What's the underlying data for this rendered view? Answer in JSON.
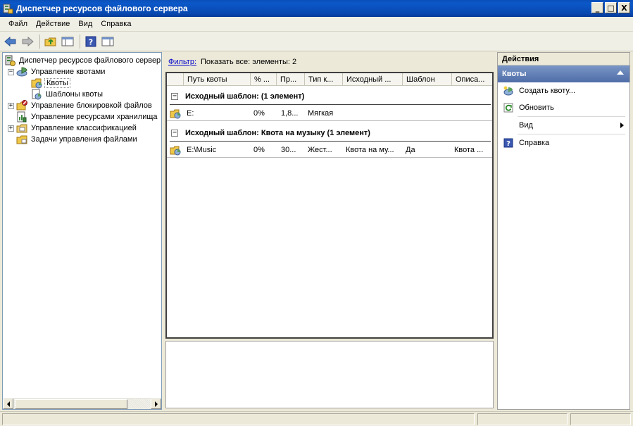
{
  "window": {
    "title": "Диспетчер ресурсов файлового сервера",
    "minimize": "_",
    "maximize": "□",
    "close": "X"
  },
  "menu": [
    "Файл",
    "Действие",
    "Вид",
    "Справка"
  ],
  "tree": [
    {
      "label": "Диспетчер ресурсов файлового сервер",
      "icon": "server-icon",
      "indent": 0,
      "expander": ""
    },
    {
      "label": "Управление квотами",
      "icon": "quota-management-icon",
      "indent": 1,
      "expander": "−"
    },
    {
      "label": "Квоты",
      "icon": "quota-folder-icon",
      "indent": 2,
      "expander": "",
      "selected": true
    },
    {
      "label": "Шаблоны квоты",
      "icon": "quota-template-icon",
      "indent": 2,
      "expander": ""
    },
    {
      "label": "Управление блокировкой файлов",
      "icon": "file-screen-icon",
      "indent": 1,
      "expander": "+"
    },
    {
      "label": "Управление ресурсами хранилища",
      "icon": "storage-report-icon",
      "indent": 1,
      "expander": ""
    },
    {
      "label": "Управление классификацией",
      "icon": "classification-icon",
      "indent": 1,
      "expander": "+"
    },
    {
      "label": "Задачи управления файлами",
      "icon": "file-tasks-icon",
      "indent": 1,
      "expander": ""
    }
  ],
  "filter": {
    "link": "Фильтр:",
    "text": "Показать все: элементы: 2"
  },
  "columns": [
    "Путь квоты",
    "% ...",
    "Пр...",
    "Тип к...",
    "Исходный ...",
    "Шаблон",
    "Описа..."
  ],
  "groups": [
    {
      "label": "Исходный шаблон:  (1 элемент)",
      "expander": "−",
      "rows": [
        {
          "path": "E:",
          "percent": "0%",
          "limit": "1,8...",
          "type": "Мягкая",
          "source": "",
          "template": "",
          "description": ""
        }
      ]
    },
    {
      "label": "Исходный шаблон: Квота на музыку (1 элемент)",
      "expander": "−",
      "rows": [
        {
          "path": "E:\\Music",
          "percent": "0%",
          "limit": "30...",
          "type": "Жест...",
          "source": "Квота на му...",
          "template": "Да",
          "description": "Квота ..."
        }
      ]
    }
  ],
  "actions": {
    "header": "Действия",
    "section": "Квоты",
    "items": [
      {
        "label": "Создать квоту...",
        "icon": "create-quota-icon"
      },
      {
        "label": "Обновить",
        "icon": "refresh-icon"
      },
      {
        "label": "Вид",
        "icon": "",
        "submenu": true
      },
      {
        "label": "Справка",
        "icon": "help-icon"
      }
    ]
  },
  "colors": {
    "titlebar": "#0a4fb8",
    "actions_section": "#5a78b0",
    "link": "#0000cc"
  }
}
